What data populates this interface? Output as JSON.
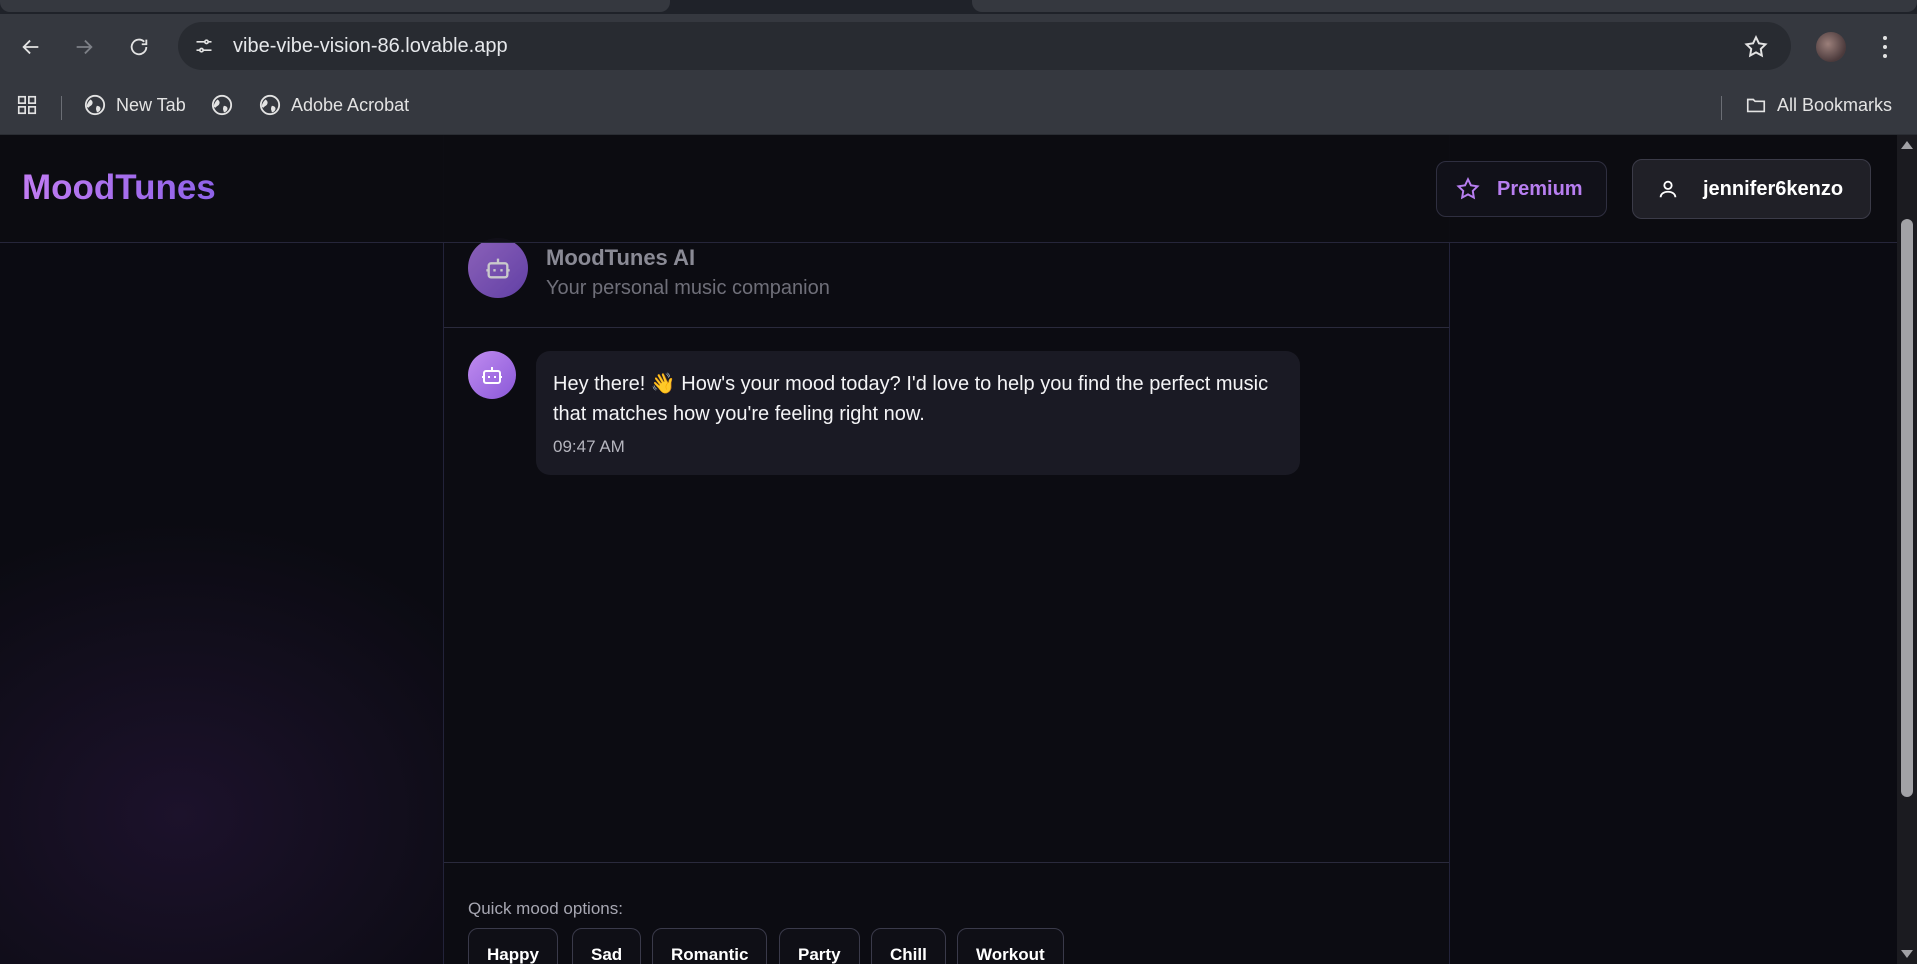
{
  "browser": {
    "url": "vibe-vibe-vision-86.lovable.app",
    "bookmarks": {
      "new_tab": "New Tab",
      "adobe": "Adobe Acrobat",
      "all_bookmarks": "All Bookmarks"
    }
  },
  "header": {
    "logo": "MoodTunes",
    "premium_label": "Premium",
    "username": "jennifer6kenzo"
  },
  "chat": {
    "title": "MoodTunes AI",
    "subtitle": "Your personal music companion",
    "messages": [
      {
        "text": "Hey there! 👋 How's your mood today? I'd love to help you find the perfect music that matches how you're feeling right now.",
        "time": "09:47 AM"
      }
    ],
    "quick_mood_label": "Quick mood options:",
    "moods": [
      "Happy",
      "Sad",
      "Romantic",
      "Party",
      "Chill",
      "Workout"
    ]
  },
  "colors": {
    "accent": "#b77ef0",
    "background": "#0b0b12",
    "bubble": "#1a1a24"
  }
}
